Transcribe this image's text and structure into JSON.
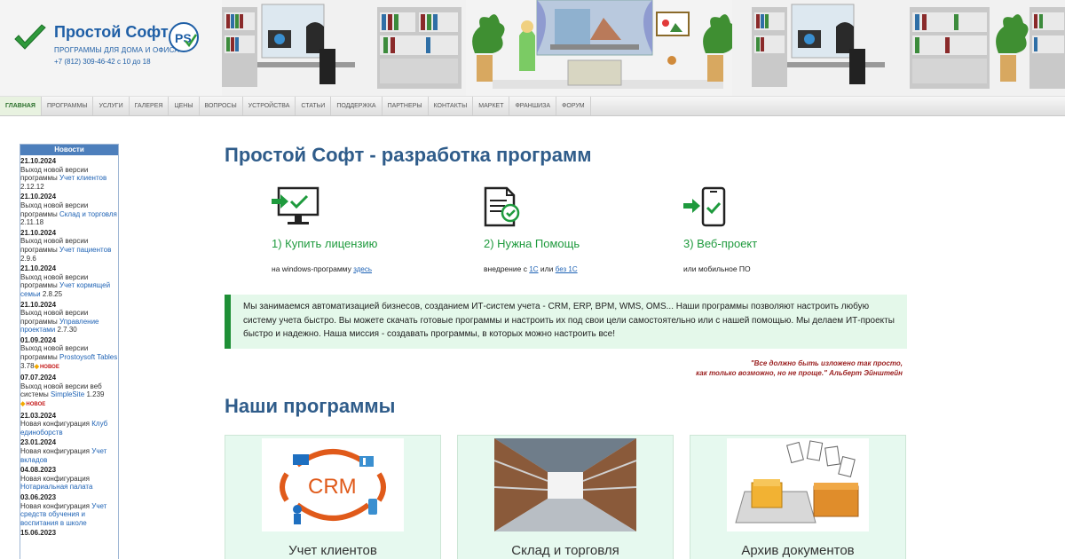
{
  "header": {
    "logo_title": "Простой Софт",
    "logo_subtitle": "ПРОГРАММЫ ДЛЯ ДОМА И ОФИСА",
    "logo_phone": "+7 (812) 309-46-42 с 10 до 18",
    "badge_text": "PS"
  },
  "nav": {
    "items": [
      {
        "label": "Главная"
      },
      {
        "label": "Программы"
      },
      {
        "label": "Услуги"
      },
      {
        "label": "Галерея"
      },
      {
        "label": "Цены"
      },
      {
        "label": "Вопросы"
      },
      {
        "label": "Устройства"
      },
      {
        "label": "Статьи"
      },
      {
        "label": "Поддержка"
      },
      {
        "label": "Партнеры"
      },
      {
        "label": "Контакты"
      },
      {
        "label": "Маркет"
      },
      {
        "label": "Франшиза"
      },
      {
        "label": "Форум"
      }
    ]
  },
  "sidebar": {
    "title": "Новости",
    "new_badge": "НОВОЕ",
    "news": [
      {
        "date": "21.10.2024",
        "text": "Выход новой версии программы ",
        "link": "Учет клиентов",
        "suffix": " 2.12.12",
        "new": false
      },
      {
        "date": "21.10.2024",
        "text": "Выход новой версии программы ",
        "link": "Склад и торговля",
        "suffix": " 2.11.18",
        "new": false
      },
      {
        "date": "21.10.2024",
        "text": "Выход новой версии программы ",
        "link": "Учет пациентов",
        "suffix": " 2.9.6",
        "new": false
      },
      {
        "date": "21.10.2024",
        "text": "Выход новой версии программы ",
        "link": "Учет кормящей семьи",
        "suffix": " 2.8.25",
        "new": false
      },
      {
        "date": "21.10.2024",
        "text": "Выход новой версии программы ",
        "link": "Управление проектами",
        "suffix": " 2.7.30",
        "new": false
      },
      {
        "date": "01.09.2024",
        "text": "Выход новой версии программы ",
        "link": "Prostoysoft Tables",
        "suffix": " 3.78",
        "new": true
      },
      {
        "date": "07.07.2024",
        "text": "Выход новой версии веб системы ",
        "link": "SimpleSite",
        "suffix": " 1.239",
        "new": true
      },
      {
        "date": "21.03.2024",
        "text": "Новая конфигурация ",
        "link": "Клуб единоборств",
        "suffix": "",
        "new": false
      },
      {
        "date": "23.01.2024",
        "text": "Новая конфигурация ",
        "link": "Учет вкладов",
        "suffix": "",
        "new": false
      },
      {
        "date": "04.08.2023",
        "text": "Новая конфигурация ",
        "link": "Нотариальная палата",
        "suffix": "",
        "new": false
      },
      {
        "date": "03.06.2023",
        "text": "Новая конфигурация ",
        "link": "Учет средств обучения и воспитания в школе",
        "suffix": "",
        "new": false
      },
      {
        "date": "15.06.2023",
        "text": "",
        "link": "",
        "suffix": "",
        "new": false
      }
    ]
  },
  "main": {
    "title": "Простой Софт - разработка программ",
    "steps": [
      {
        "icon": "monitor-check-icon",
        "title": "1) Купить лицензию",
        "sub": "на windows-программу ",
        "link": "здесь",
        "link2": ""
      },
      {
        "icon": "document-badge-icon",
        "title": "2) Нужна Помощь",
        "sub": "внедрение с ",
        "link": "1С",
        "mid": " или ",
        "link2": "без 1С"
      },
      {
        "icon": "phone-check-icon",
        "title": "3) Веб-проект",
        "sub": "или мобильное ПО",
        "link": "",
        "link2": ""
      }
    ],
    "about": "Мы занимаемся автоматизацией бизнесов, созданием ИТ-систем учета - CRM, ERP, BPM, WMS, OMS... Наши программы позволяют настроить любую систему учета быстро. Вы можете скачать готовые программы и настроить их под свои цели самостоятельно или с нашей помощью. Мы делаем ИТ-проекты быстро и надежно. Наша миссия - создавать программы, в которых можно настроить все!",
    "quote_line1": "\"Все должно быть изложено так просто,",
    "quote_line2": "как только возможно, но не проще.\" Альберт Эйнштейн",
    "programs_title": "Наши программы",
    "programs": [
      {
        "title": "Учет клиентов",
        "image_text": "CRM"
      },
      {
        "title": "Склад и торговля",
        "image_text": ""
      },
      {
        "title": "Архив документов",
        "image_text": ""
      }
    ]
  }
}
